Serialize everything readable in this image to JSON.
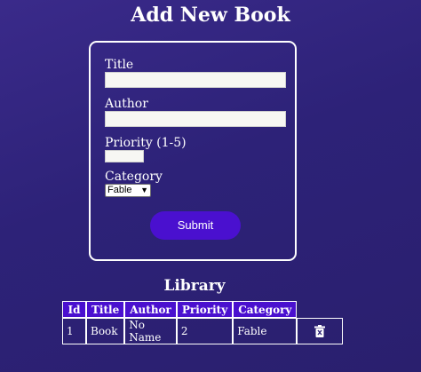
{
  "header": {
    "title": "Add New Book"
  },
  "form": {
    "title_label": "Title",
    "title_value": "",
    "author_label": "Author",
    "author_value": "",
    "priority_label": "Priority (1-5)",
    "priority_value": "",
    "category_label": "Category",
    "category_selected": "Fable",
    "submit_label": "Submit"
  },
  "library": {
    "title": "Library",
    "columns": [
      "Id",
      "Title",
      "Author",
      "Priority",
      "Category"
    ],
    "rows": [
      {
        "id": "1",
        "title": "Book",
        "author": "No Name",
        "priority": "2",
        "category": "Fable"
      }
    ]
  },
  "icons": {
    "delete": "trash-icon",
    "select": "chevron-down-icon"
  },
  "colors": {
    "accent": "#4a10cf",
    "background": "#2d2278",
    "border": "#ffffff"
  }
}
